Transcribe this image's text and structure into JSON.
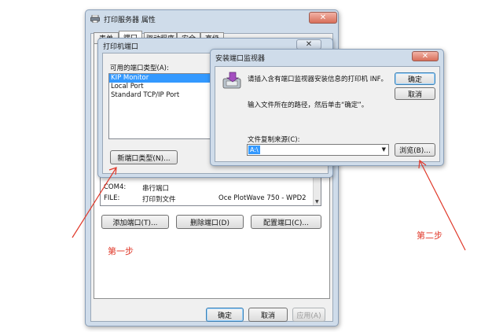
{
  "main_window": {
    "title": "打印服务器 属性",
    "tabs": [
      "表单",
      "端口",
      "驱动程序",
      "安全",
      "高级"
    ],
    "ports_rows": [
      {
        "port": "COM4:",
        "desc": "串行端口",
        "printer": ""
      },
      {
        "port": "FILE:",
        "desc": "打印到文件",
        "printer": "Oce PlotWave 750 - WPD2"
      }
    ],
    "add_port": "添加端口(T)...",
    "delete_port": "删除端口(D)",
    "config_port": "配置端口(C)...",
    "ok": "确定",
    "cancel": "取消",
    "apply": "应用(A)"
  },
  "printer_ports_dialog": {
    "title": "打印机端口",
    "available_label": "可用的端口类型(A):",
    "port_types": [
      "KIP Monitor",
      "Local Port",
      "Standard TCP/IP Port"
    ],
    "new_port_type": "新端口类型(N)..."
  },
  "install_monitor_dialog": {
    "title": "安装端口监视器",
    "instruction1": "请插入含有端口监视器安装信息的打印机 INF。",
    "instruction2": "输入文件所在的路径，然后单击“确定”。",
    "copy_from_label": "文件复制来源(C):",
    "copy_from_value": "A:\\",
    "ok": "确定",
    "cancel": "取消",
    "browse": "浏览(B)..."
  },
  "annotations": {
    "step1": "第一步",
    "step2": "第二步"
  },
  "colors": {
    "annotation": "#e0392a",
    "selection": "#3399ff"
  }
}
